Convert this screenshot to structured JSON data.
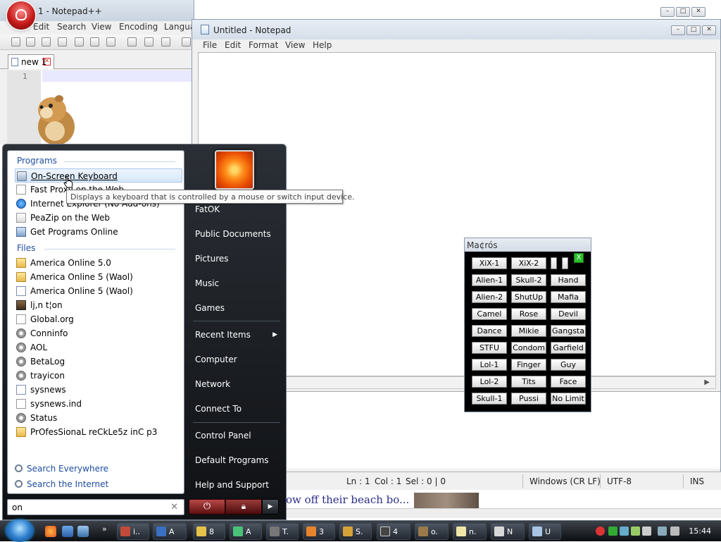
{
  "notepadpp": {
    "title": "1 - Notepad++",
    "menu": [
      "Edit",
      "Search",
      "View",
      "Encoding",
      "Langua"
    ],
    "tab_label": "new 1",
    "line_number": "1"
  },
  "notepad": {
    "title": "Untitled - Notepad",
    "menu": [
      "File",
      "Edit",
      "Format",
      "View",
      "Help"
    ]
  },
  "statusbar": {
    "ln": "Ln : 1",
    "col": "Col : 1",
    "sel": "Sel : 0 | 0",
    "eol": "Windows (CR LF)",
    "encoding": "UTF-8",
    "mode": "INS"
  },
  "web_strip": {
    "text": "ow off their beach bo..."
  },
  "macros": {
    "title": "Ma¢rós",
    "buttons": [
      [
        "XiX-1",
        "XiX-2"
      ],
      [
        "Alien-1",
        "Skull-2",
        "Hand"
      ],
      [
        "Alien-2",
        "ShutUp",
        "Mafia"
      ],
      [
        "Camel",
        "Rose",
        "Devil"
      ],
      [
        "Dance",
        "Mikie",
        "Gangsta"
      ],
      [
        "STFU",
        "Condom",
        "Garfield"
      ],
      [
        "Lol-1",
        "Finger",
        "Guy"
      ],
      [
        "Lol-2",
        "Tits",
        "Face"
      ],
      [
        "Skull-1",
        "Pussi",
        "No Limit"
      ]
    ],
    "close_glyph": "X"
  },
  "start_menu": {
    "programs_header": "Programs",
    "programs": [
      {
        "label": "On-Screen Keyboard",
        "icon": "keyboard-icon"
      },
      {
        "label": "Fast Proxy on the Web",
        "icon": "document-icon"
      },
      {
        "label": "Internet Explorer (No Add-ons)",
        "icon": "internet-explorer-icon"
      },
      {
        "label": "PeaZip on the Web",
        "icon": "document-icon"
      },
      {
        "label": "Get Programs Online",
        "icon": "programs-icon"
      }
    ],
    "files_header": "Files",
    "files": [
      {
        "label": "America Online 5.0",
        "icon": "folder-icon"
      },
      {
        "label": "America Online 5 (Waol)",
        "icon": "folder-icon"
      },
      {
        "label": "America Online 5 (Waol)",
        "icon": "document-icon"
      },
      {
        "label": "lj,n t¦on",
        "icon": "picture-icon"
      },
      {
        "label": "Global.org",
        "icon": "document-icon"
      },
      {
        "label": "Conninfo",
        "icon": "settings-file-icon"
      },
      {
        "label": "AOL",
        "icon": "settings-file-icon"
      },
      {
        "label": "BetaLog",
        "icon": "settings-file-icon"
      },
      {
        "label": "trayicon",
        "icon": "settings-file-icon"
      },
      {
        "label": "sysnews",
        "icon": "document-icon"
      },
      {
        "label": "sysnews.ind",
        "icon": "document-icon"
      },
      {
        "label": "Status",
        "icon": "settings-file-icon"
      },
      {
        "label": "PrOfesSionaL reCkLe5z inC p3",
        "icon": "folder-icon"
      }
    ],
    "search_everywhere": "Search Everywhere",
    "search_internet": "Search the Internet",
    "search_value": "on",
    "right_items": [
      "FatOK",
      "Public Documents",
      "Pictures",
      "Music",
      "Games",
      "Recent Items",
      "Computer",
      "Network",
      "Connect To",
      "Control Panel",
      "Default Programs",
      "Help and Support"
    ]
  },
  "tooltip": "Displays a keyboard that is controlled by a mouse or switch input device.",
  "taskbar": {
    "buttons": [
      "i..",
      "A",
      "8",
      "A",
      "T.",
      "3",
      "S.",
      "4",
      "o.",
      "n.",
      "N",
      "U"
    ],
    "clock": "15:44"
  },
  "colors": {
    "start_menu_bg": "#1a1d22",
    "macros_bg": "#000000",
    "link_blue": "#1c4d9e",
    "taskbar_bg": "#1e2228"
  }
}
